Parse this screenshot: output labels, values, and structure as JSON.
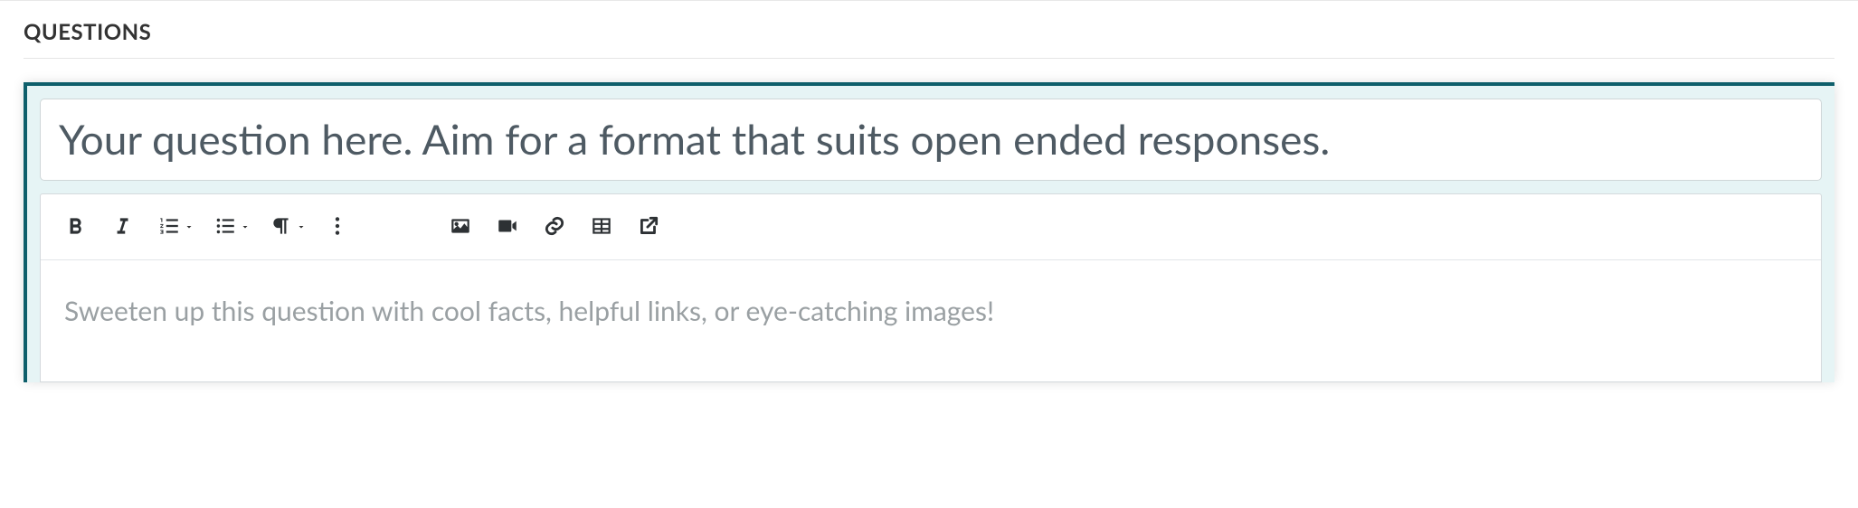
{
  "section": {
    "title": "QUESTIONS"
  },
  "question": {
    "placeholder": "Your question here. Aim for a format that suits open ended responses.",
    "value": ""
  },
  "editor": {
    "placeholder": "Sweeten up this question with cool facts, helpful links, or eye-catching images!"
  },
  "toolbar": {
    "icons": {
      "bold": "bold",
      "italic": "italic",
      "ordered_list": "ordered-list",
      "unordered_list": "unordered-list",
      "paragraph": "paragraph",
      "more": "more",
      "image": "image",
      "video": "video",
      "link": "link",
      "table": "table",
      "external": "external"
    }
  }
}
